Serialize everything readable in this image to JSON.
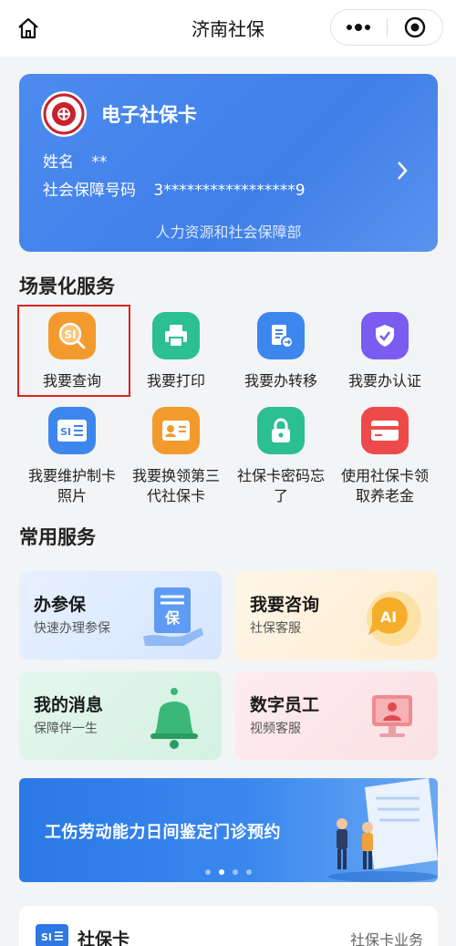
{
  "header": {
    "title": "济南社保"
  },
  "card": {
    "title": "电子社保卡",
    "name_label": "姓名",
    "name_value": "**",
    "id_label": "社会保障号码",
    "id_value": "3*****************9",
    "issuer": "人力资源和社会保障部",
    "emblem_text": "SOCIAL SECURITY CARD"
  },
  "scene": {
    "title": "场景化服务",
    "items": [
      {
        "label": "我要查询",
        "icon": "query-icon",
        "color": "#f39a2c"
      },
      {
        "label": "我要打印",
        "icon": "printer-icon",
        "color": "#2bbf91"
      },
      {
        "label": "我要办转移",
        "icon": "transfer-document-icon",
        "color": "#3d86ee"
      },
      {
        "label": "我要办认证",
        "icon": "shield-check-icon",
        "color": "#7a5cf0"
      },
      {
        "label": "我要维护制卡照片",
        "icon": "si-card-icon",
        "color": "#3d86ee"
      },
      {
        "label": "我要换领第三代社保卡",
        "icon": "id-card-icon",
        "color": "#f39a2c"
      },
      {
        "label": "社保卡密码忘了",
        "icon": "lock-icon",
        "color": "#2bbf91"
      },
      {
        "label": "使用社保卡领取养老金",
        "icon": "card-icon",
        "color": "#ee4a4a"
      }
    ]
  },
  "common": {
    "title": "常用服务",
    "tiles": [
      {
        "title": "办参保",
        "subtitle": "快速办理参保",
        "icon": "insurance-document-icon",
        "badge": "保"
      },
      {
        "title": "我要咨询",
        "subtitle": "社保客服",
        "icon": "ai-chat-icon",
        "badge": "AI"
      },
      {
        "title": "我的消息",
        "subtitle": "保障伴一生",
        "icon": "bell-icon"
      },
      {
        "title": "数字员工",
        "subtitle": "视频客服",
        "icon": "video-monitor-icon"
      }
    ]
  },
  "banner": {
    "text": "工伤劳动能力日间鉴定门诊预约",
    "pages": 4,
    "active_page": 2
  },
  "bottom": {
    "title": "社保卡",
    "right": "社保卡业务",
    "icon_text": "SI"
  },
  "colors": {
    "accent": "#3f7fe8",
    "highlight": "#d9251c"
  }
}
